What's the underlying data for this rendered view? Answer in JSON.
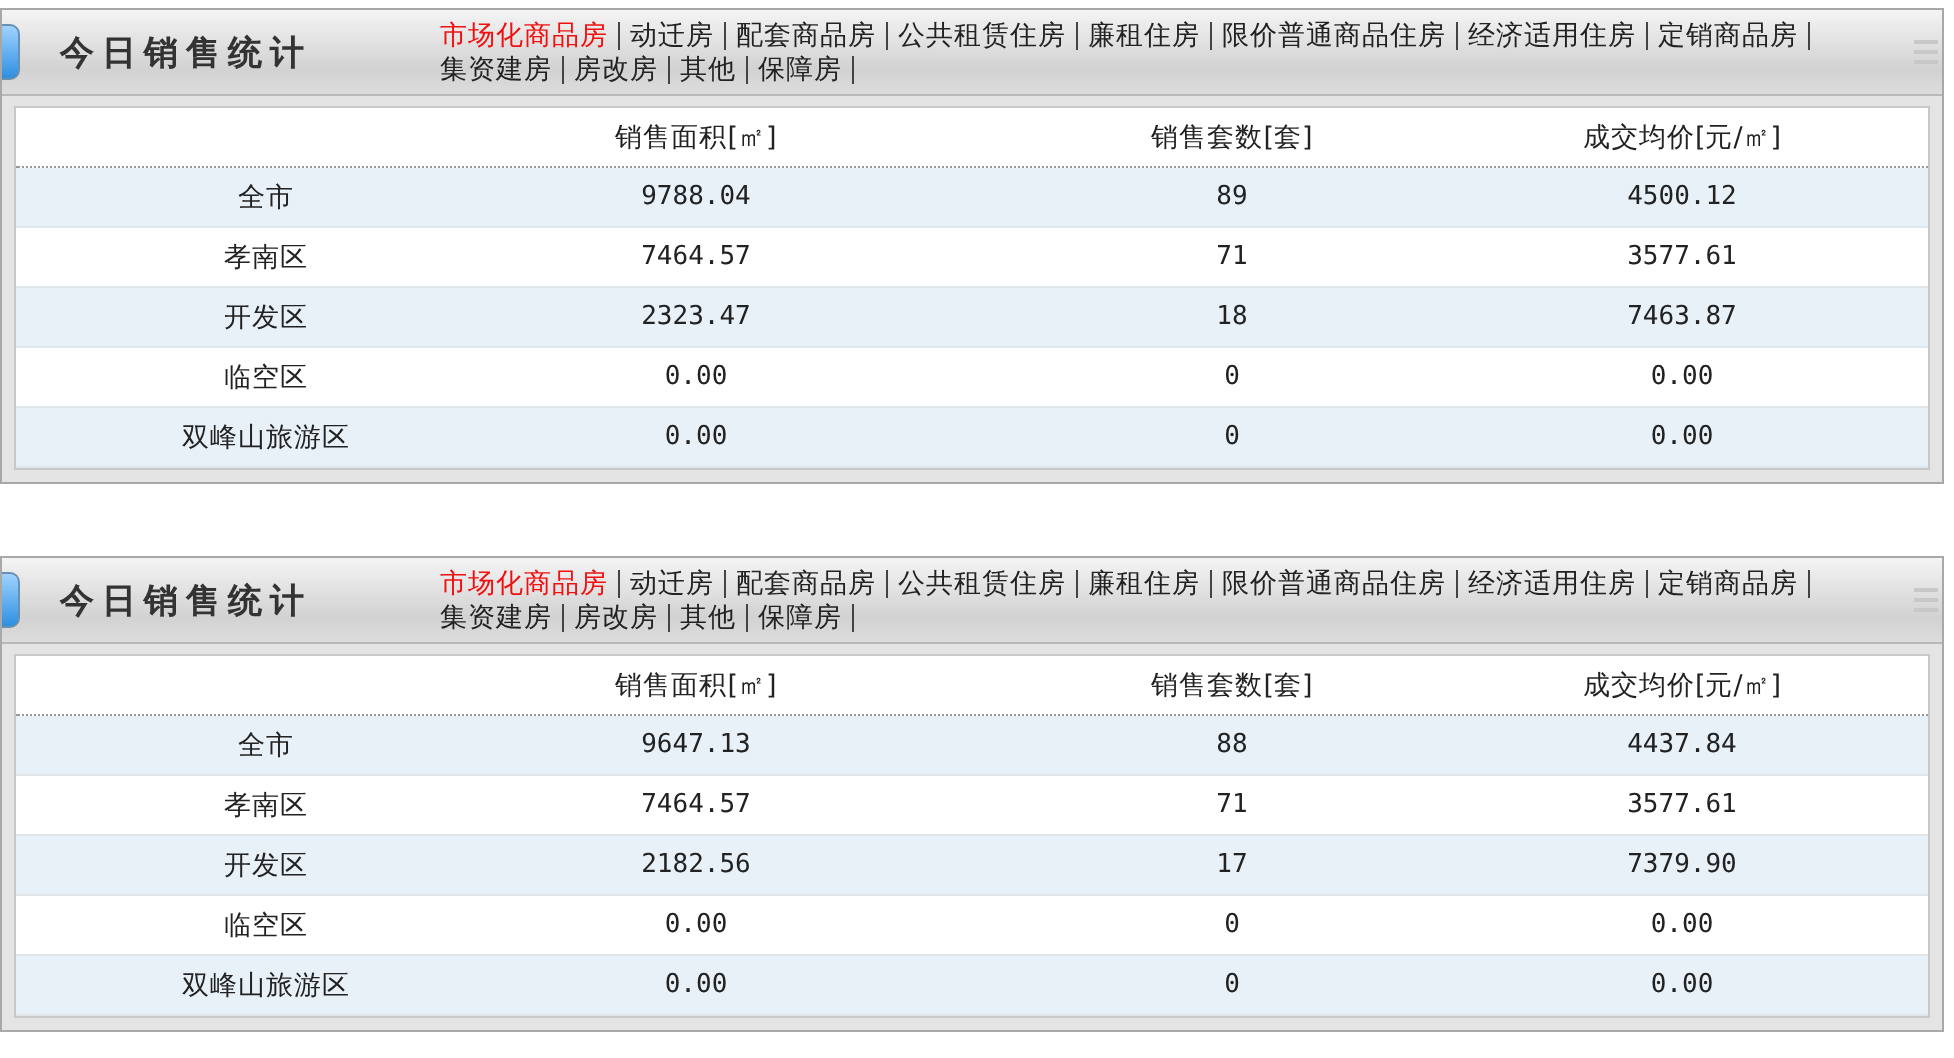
{
  "panels": [
    {
      "title": "今日销售统计",
      "tabs": [
        {
          "label": "市场化商品房",
          "selected": true
        },
        {
          "label": "动迁房",
          "selected": false
        },
        {
          "label": "配套商品房",
          "selected": false
        },
        {
          "label": "公共租赁住房",
          "selected": false
        },
        {
          "label": "廉租住房",
          "selected": false
        },
        {
          "label": "限价普通商品住房",
          "selected": false
        },
        {
          "label": "经济适用住房",
          "selected": false
        },
        {
          "label": "定销商品房",
          "selected": false
        },
        {
          "label": "集资建房",
          "selected": false
        },
        {
          "label": "房改房",
          "selected": false
        },
        {
          "label": "其他",
          "selected": false
        },
        {
          "label": "保障房",
          "selected": false
        }
      ],
      "table": {
        "columns": [
          "",
          "销售面积[㎡]",
          "销售套数[套]",
          "成交均价[元/㎡]"
        ],
        "rows": [
          [
            "全市",
            "9788.04",
            "89",
            "4500.12"
          ],
          [
            "孝南区",
            "7464.57",
            "71",
            "3577.61"
          ],
          [
            "开发区",
            "2323.47",
            "18",
            "7463.87"
          ],
          [
            "临空区",
            "0.00",
            "0",
            "0.00"
          ],
          [
            "双峰山旅游区",
            "0.00",
            "0",
            "0.00"
          ]
        ]
      }
    },
    {
      "title": "今日销售统计",
      "tabs": [
        {
          "label": "市场化商品房",
          "selected": true
        },
        {
          "label": "动迁房",
          "selected": false
        },
        {
          "label": "配套商品房",
          "selected": false
        },
        {
          "label": "公共租赁住房",
          "selected": false
        },
        {
          "label": "廉租住房",
          "selected": false
        },
        {
          "label": "限价普通商品住房",
          "selected": false
        },
        {
          "label": "经济适用住房",
          "selected": false
        },
        {
          "label": "定销商品房",
          "selected": false
        },
        {
          "label": "集资建房",
          "selected": false
        },
        {
          "label": "房改房",
          "selected": false
        },
        {
          "label": "其他",
          "selected": false
        },
        {
          "label": "保障房",
          "selected": false
        }
      ],
      "table": {
        "columns": [
          "",
          "销售面积[㎡]",
          "销售套数[套]",
          "成交均价[元/㎡]"
        ],
        "rows": [
          [
            "全市",
            "9647.13",
            "88",
            "4437.84"
          ],
          [
            "孝南区",
            "7464.57",
            "71",
            "3577.61"
          ],
          [
            "开发区",
            "2182.56",
            "17",
            "7379.90"
          ],
          [
            "临空区",
            "0.00",
            "0",
            "0.00"
          ],
          [
            "双峰山旅游区",
            "0.00",
            "0",
            "0.00"
          ]
        ]
      }
    }
  ]
}
